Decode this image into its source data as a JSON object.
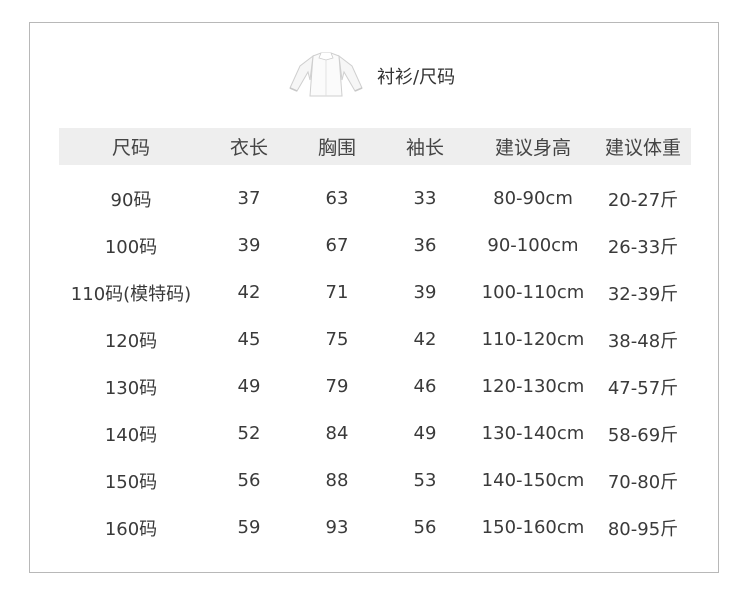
{
  "title": "衬衫/尺码",
  "headers": [
    "尺码",
    "衣长",
    "胸围",
    "袖长",
    "建议身高",
    "建议体重"
  ],
  "rows": [
    [
      "90码",
      "37",
      "63",
      "33",
      "80-90cm",
      "20-27斤"
    ],
    [
      "100码",
      "39",
      "67",
      "36",
      "90-100cm",
      "26-33斤"
    ],
    [
      "110码(模特码)",
      "42",
      "71",
      "39",
      "100-110cm",
      "32-39斤"
    ],
    [
      "120码",
      "45",
      "75",
      "42",
      "110-120cm",
      "38-48斤"
    ],
    [
      "130码",
      "49",
      "79",
      "46",
      "120-130cm",
      "47-57斤"
    ],
    [
      "140码",
      "52",
      "84",
      "49",
      "130-140cm",
      "58-69斤"
    ],
    [
      "150码",
      "56",
      "88",
      "53",
      "140-150cm",
      "70-80斤"
    ],
    [
      "160码",
      "59",
      "93",
      "56",
      "150-160cm",
      "80-95斤"
    ]
  ],
  "colors": {
    "header_bg": "#eeeeee",
    "border": "#b8b8b8",
    "text": "#3a3a3a"
  },
  "icons": {
    "product": "shirt-icon"
  }
}
